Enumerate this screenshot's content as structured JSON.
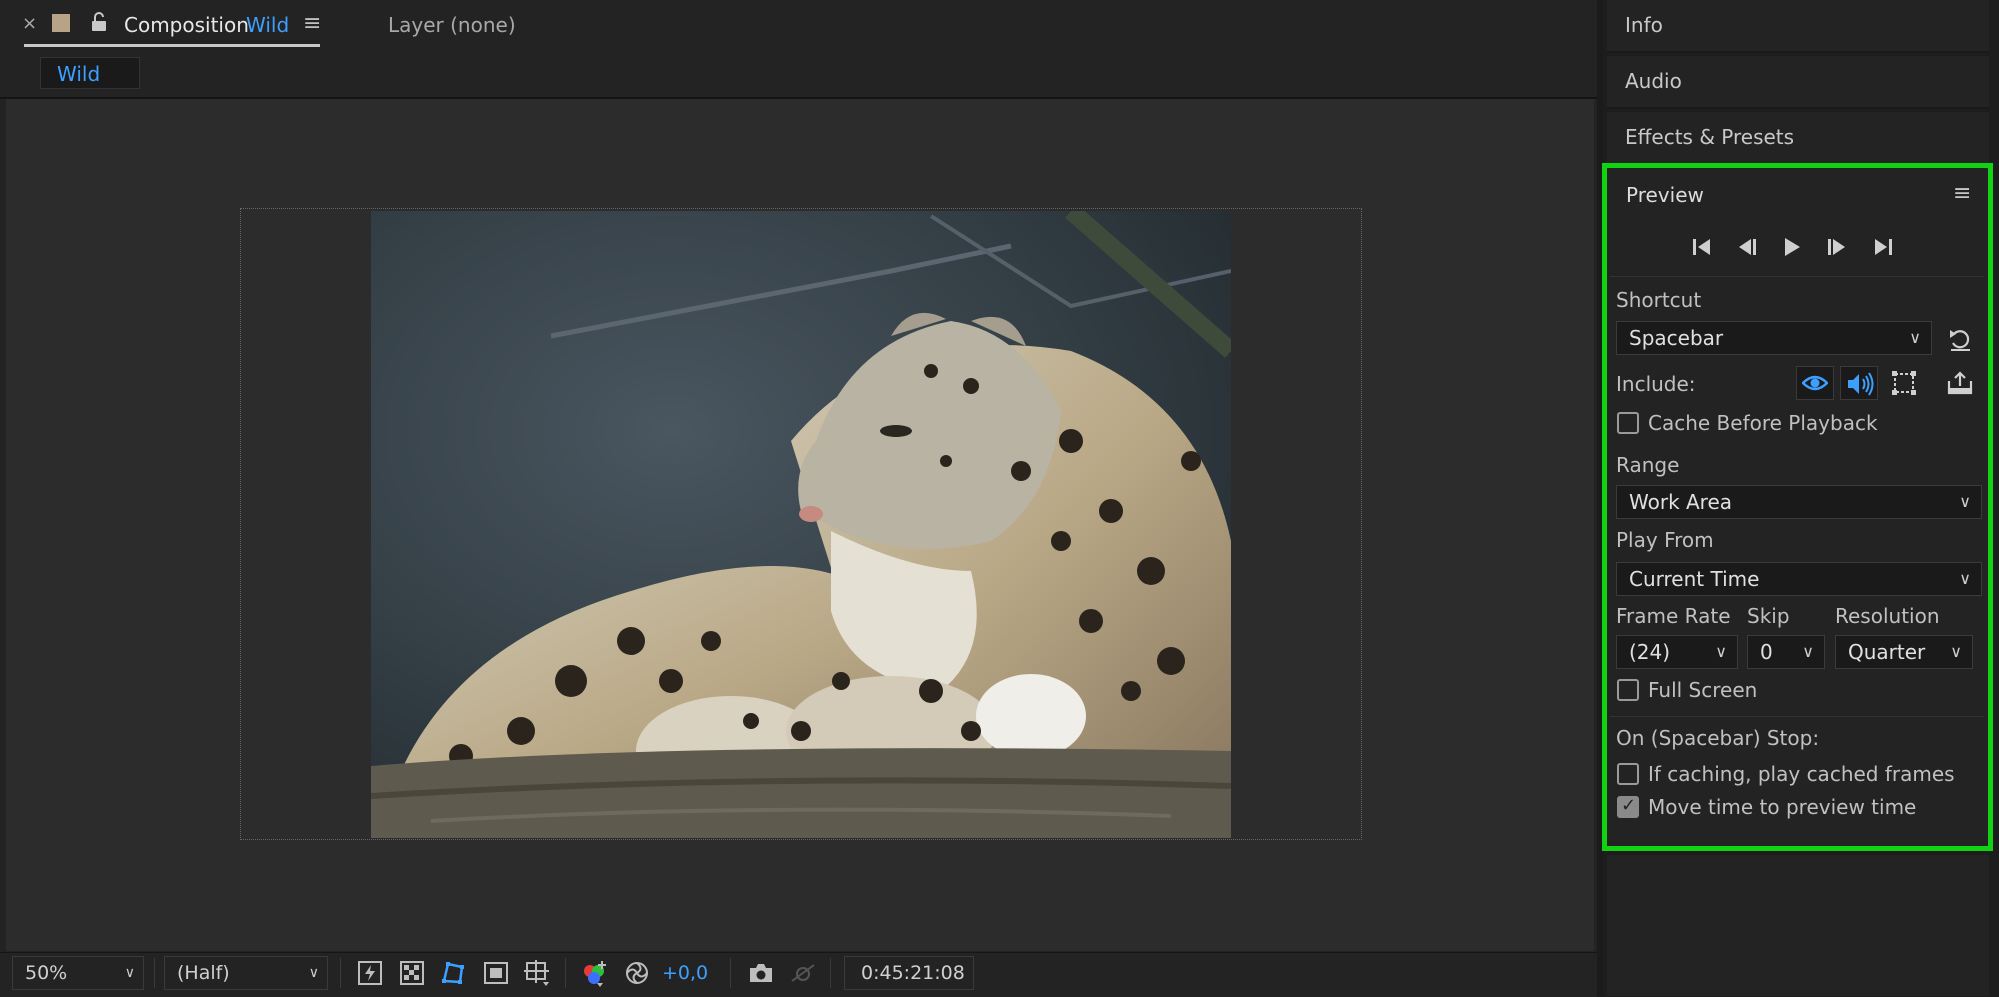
{
  "composition_tab": {
    "close": "×",
    "label": "Composition",
    "name": "Wild",
    "menu": "≡"
  },
  "layer_tab": {
    "label": "Layer (none)"
  },
  "comp_subtab": {
    "label": "Wild"
  },
  "viewer": {
    "image": "snow-leopard-photo"
  },
  "bottom_bar": {
    "zoom": "50%",
    "resolution": "(Half)",
    "exposure": "+0,0",
    "timecode": "0:45:21:08"
  },
  "right_panels": {
    "info": "Info",
    "audio": "Audio",
    "effects": "Effects & Presets"
  },
  "preview": {
    "title": "Preview",
    "menu": "≡",
    "shortcut_label": "Shortcut",
    "shortcut_value": "Spacebar",
    "include_label": "Include:",
    "cache_before_playback": "Cache Before Playback",
    "range_label": "Range",
    "range_value": "Work Area",
    "play_from_label": "Play From",
    "play_from_value": "Current Time",
    "frame_rate_label": "Frame Rate",
    "frame_rate_value": "(24)",
    "skip_label": "Skip",
    "skip_value": "0",
    "resolution_label": "Resolution",
    "resolution_value": "Quarter",
    "full_screen": "Full Screen",
    "on_stop_label": "On (Spacebar) Stop:",
    "if_caching": "If caching, play cached frames",
    "move_time": "Move time to preview time",
    "checks": {
      "cache_before_playback": false,
      "full_screen": false,
      "if_caching": false,
      "move_time": true
    }
  },
  "colors": {
    "accent_blue": "#3d9fff",
    "highlight_green": "#11d311"
  }
}
